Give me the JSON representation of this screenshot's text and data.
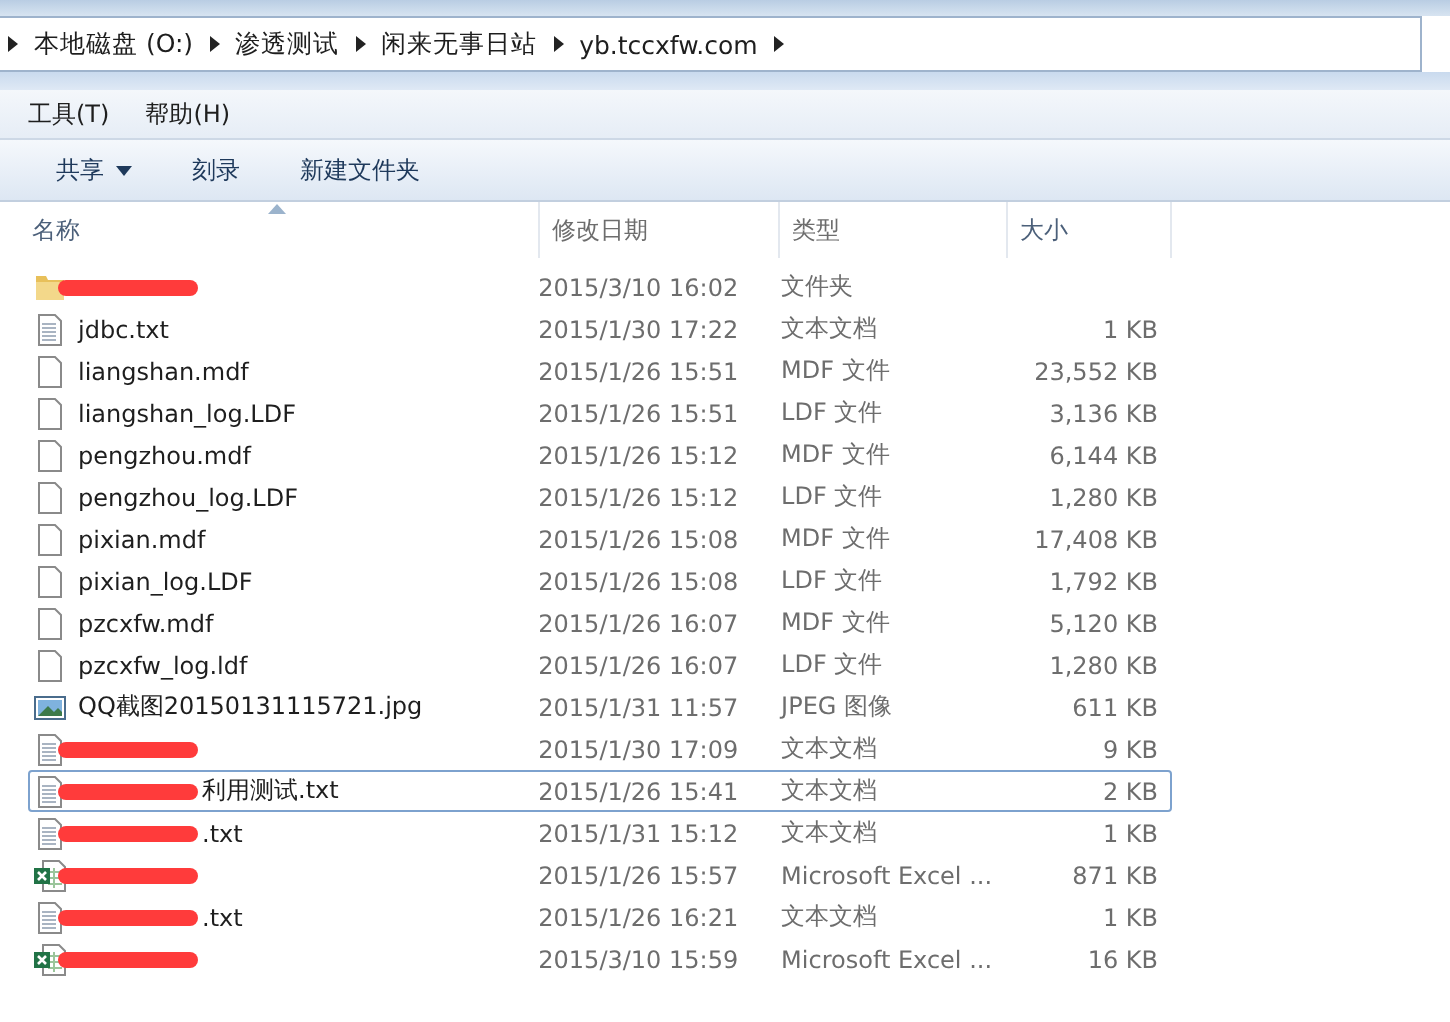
{
  "breadcrumb": [
    "本地磁盘 (O:)",
    "渗透测试",
    "闲来无事日站",
    "yb.tccxfw.com"
  ],
  "menu": [
    "工具(T)",
    "帮助(H)"
  ],
  "toolbar": [
    {
      "label": "共享",
      "dropdown": true
    },
    {
      "label": "刻录",
      "dropdown": false
    },
    {
      "label": "新建文件夹",
      "dropdown": false
    }
  ],
  "columns": [
    "名称",
    "修改日期",
    "类型",
    "大小"
  ],
  "rows": [
    {
      "kind": "folder",
      "name": "",
      "redacted": true,
      "focused": false,
      "date": "2015/3/10 16:02",
      "type": "文件夹",
      "size": ""
    },
    {
      "kind": "text",
      "name": "jdbc.txt",
      "redacted": false,
      "focused": false,
      "date": "2015/1/30 17:22",
      "type": "文本文档",
      "size": "1 KB"
    },
    {
      "kind": "file",
      "name": "liangshan.mdf",
      "redacted": false,
      "focused": false,
      "date": "2015/1/26 15:51",
      "type": "MDF 文件",
      "size": "23,552 KB"
    },
    {
      "kind": "file",
      "name": "liangshan_log.LDF",
      "redacted": false,
      "focused": false,
      "date": "2015/1/26 15:51",
      "type": "LDF 文件",
      "size": "3,136 KB"
    },
    {
      "kind": "file",
      "name": "pengzhou.mdf",
      "redacted": false,
      "focused": false,
      "date": "2015/1/26 15:12",
      "type": "MDF 文件",
      "size": "6,144 KB"
    },
    {
      "kind": "file",
      "name": "pengzhou_log.LDF",
      "redacted": false,
      "focused": false,
      "date": "2015/1/26 15:12",
      "type": "LDF 文件",
      "size": "1,280 KB"
    },
    {
      "kind": "file",
      "name": "pixian.mdf",
      "redacted": false,
      "focused": false,
      "date": "2015/1/26 15:08",
      "type": "MDF 文件",
      "size": "17,408 KB"
    },
    {
      "kind": "file",
      "name": "pixian_log.LDF",
      "redacted": false,
      "focused": false,
      "date": "2015/1/26 15:08",
      "type": "LDF 文件",
      "size": "1,792 KB"
    },
    {
      "kind": "file",
      "name": "pzcxfw.mdf",
      "redacted": false,
      "focused": false,
      "date": "2015/1/26 16:07",
      "type": "MDF 文件",
      "size": "5,120 KB"
    },
    {
      "kind": "file",
      "name": "pzcxfw_log.ldf",
      "redacted": false,
      "focused": false,
      "date": "2015/1/26 16:07",
      "type": "LDF 文件",
      "size": "1,280 KB"
    },
    {
      "kind": "image",
      "name": "QQ截图20150131115721.jpg",
      "redacted": false,
      "focused": false,
      "date": "2015/1/31 11:57",
      "type": "JPEG 图像",
      "size": "611 KB"
    },
    {
      "kind": "text",
      "name": "",
      "redacted": true,
      "focused": false,
      "date": "2015/1/30 17:09",
      "type": "文本文档",
      "size": "9 KB"
    },
    {
      "kind": "text",
      "name": "利用测试.txt",
      "redacted": true,
      "focused": true,
      "date": "2015/1/26 15:41",
      "type": "文本文档",
      "size": "2 KB"
    },
    {
      "kind": "text",
      "name": ".txt",
      "redacted": true,
      "focused": false,
      "date": "2015/1/31 15:12",
      "type": "文本文档",
      "size": "1 KB"
    },
    {
      "kind": "excel",
      "name": "",
      "redacted": true,
      "focused": false,
      "date": "2015/1/26 15:57",
      "type": "Microsoft Excel ...",
      "size": "871 KB"
    },
    {
      "kind": "text",
      "name": ".txt",
      "redacted": true,
      "focused": false,
      "date": "2015/1/26 16:21",
      "type": "文本文档",
      "size": "1 KB"
    },
    {
      "kind": "excel",
      "name": "",
      "redacted": true,
      "focused": false,
      "date": "2015/3/10 15:59",
      "type": "Microsoft Excel ...",
      "size": "16 KB"
    }
  ]
}
